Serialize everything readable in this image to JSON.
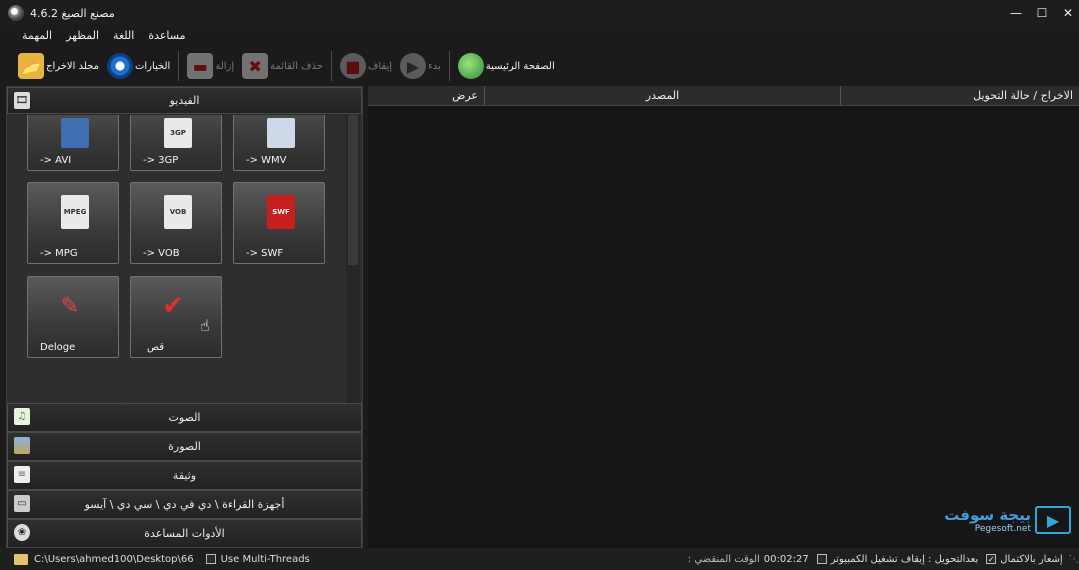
{
  "window": {
    "title": "مصنع الصيغ 4.6.2"
  },
  "menu": [
    "المهمة",
    "المظهر",
    "اللغة",
    "مساعدة"
  ],
  "toolbar": {
    "output_folder": "مجلد الاخراج",
    "options": "الخيارات",
    "remove": "إزالة",
    "clear_list": "حذف القائمة",
    "stop": "إيقاف",
    "start": "بدء",
    "homepage": "الصفحة الرئيسية"
  },
  "categories": {
    "video": "الفيديو",
    "audio": "الصوت",
    "picture": "الصورة",
    "document": "وثيقة",
    "rom": "أجهزة القراءة \\ دي في دي \\ سي دي \\ آيسو",
    "utilities": "الأدوات المساعدة"
  },
  "tiles": [
    {
      "label": "-> AVI",
      "badge": ""
    },
    {
      "label": "-> 3GP",
      "badge": "3GP"
    },
    {
      "label": "-> WMV",
      "badge": ""
    },
    {
      "label": "-> MPG",
      "badge": "MPEG"
    },
    {
      "label": "-> VOB",
      "badge": "VOB"
    },
    {
      "label": "-> SWF",
      "badge": "SWF"
    },
    {
      "label": "Deloge",
      "badge": ""
    },
    {
      "label": "قص",
      "badge": ""
    }
  ],
  "table": {
    "col_preview": "عرض",
    "col_source": "المصدر",
    "col_output": "الاخراج / حالة التحويل"
  },
  "watermark": {
    "arabic": "بيجة سوفت",
    "english": "Pegesoft.net"
  },
  "status": {
    "path": "C:\\Users\\ahmed100\\Desktop\\66",
    "multithreads": "Use Multi-Threads",
    "elapsed_value": "00:02:27",
    "elapsed_label": ": الوقت المنقضي",
    "after_convert": "بعدالتحويل : إيقاف تشغيل الكمبيوتر",
    "notify": "إشعار بالاكتمال"
  }
}
